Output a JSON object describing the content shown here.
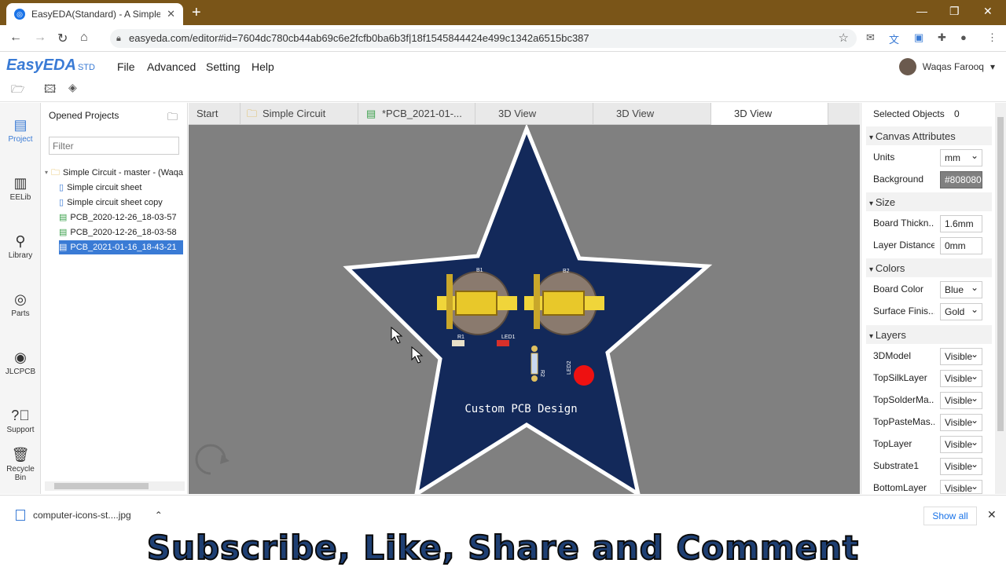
{
  "browser": {
    "tab_title": "EasyEDA(Standard) - A Simple an",
    "url": "easyeda.com/editor#id=7604dc780cb44ab69c6e2fcfb0ba6b3f|18f1545844424e499c1342a6515bc387"
  },
  "app": {
    "logo": "EasyEDA",
    "logo_suffix": "STD",
    "menu": [
      "File",
      "Advanced",
      "Setting",
      "Help"
    ],
    "user": "Waqas Farooq"
  },
  "rail": [
    {
      "label": "Project",
      "icon": "project-icon"
    },
    {
      "label": "EELib",
      "icon": "eelib-icon"
    },
    {
      "label": "Library",
      "icon": "library-icon"
    },
    {
      "label": "Parts",
      "icon": "parts-icon"
    },
    {
      "label": "JLCPCB",
      "icon": "jlcpcb-icon"
    },
    {
      "label": "Support",
      "icon": "support-icon"
    },
    {
      "label": "Recycle Bin",
      "icon": "recycle-bin-icon"
    }
  ],
  "projects": {
    "header": "Opened Projects",
    "filter_placeholder": "Filter",
    "root": "Simple Circuit - master - (Waqa",
    "items": [
      "Simple circuit sheet",
      "Simple circuit sheet copy",
      "PCB_2020-12-26_18-03-57",
      "PCB_2020-12-26_18-03-58",
      "PCB_2021-01-16_18-43-21"
    ]
  },
  "tabs": [
    "Start",
    "Simple Circuit",
    "*PCB_2021-01-...",
    "3D View",
    "3D View",
    "3D View"
  ],
  "canvas": {
    "board_text": "Custom PCB Design",
    "labels": [
      "B1",
      "B2",
      "R1",
      "LED1",
      "R2",
      "LED2"
    ],
    "board_color": "#13295a",
    "background": "#808080"
  },
  "props": {
    "selected_label": "Selected Objects",
    "selected_count": "0",
    "canvas_section": "Canvas Attributes",
    "units_label": "Units",
    "units_value": "mm",
    "background_label": "Background",
    "background_value": "#808080",
    "size_section": "Size",
    "thickness_label": "Board Thickn...",
    "thickness_value": "1.6mm",
    "layer_distance_label": "Layer Distance",
    "layer_distance_value": "0mm",
    "colors_section": "Colors",
    "board_color_label": "Board Color",
    "board_color_value": "Blue",
    "surface_label": "Surface Finis...",
    "surface_value": "Gold",
    "layers_section": "Layers",
    "layers": [
      {
        "name": "3DModel",
        "value": "Visible"
      },
      {
        "name": "TopSilkLayer",
        "value": "Visible"
      },
      {
        "name": "TopSolderMa...",
        "value": "Visible"
      },
      {
        "name": "TopPasteMas...",
        "value": "Visible"
      },
      {
        "name": "TopLayer",
        "value": "Visible"
      },
      {
        "name": "Substrate1",
        "value": "Visible"
      },
      {
        "name": "BottomLayer",
        "value": "Visible"
      }
    ]
  },
  "downloads": {
    "file": "computer-icons-st....jpg",
    "show_all": "Show all"
  },
  "banner": "Subscribe, Like, Share and Comment"
}
